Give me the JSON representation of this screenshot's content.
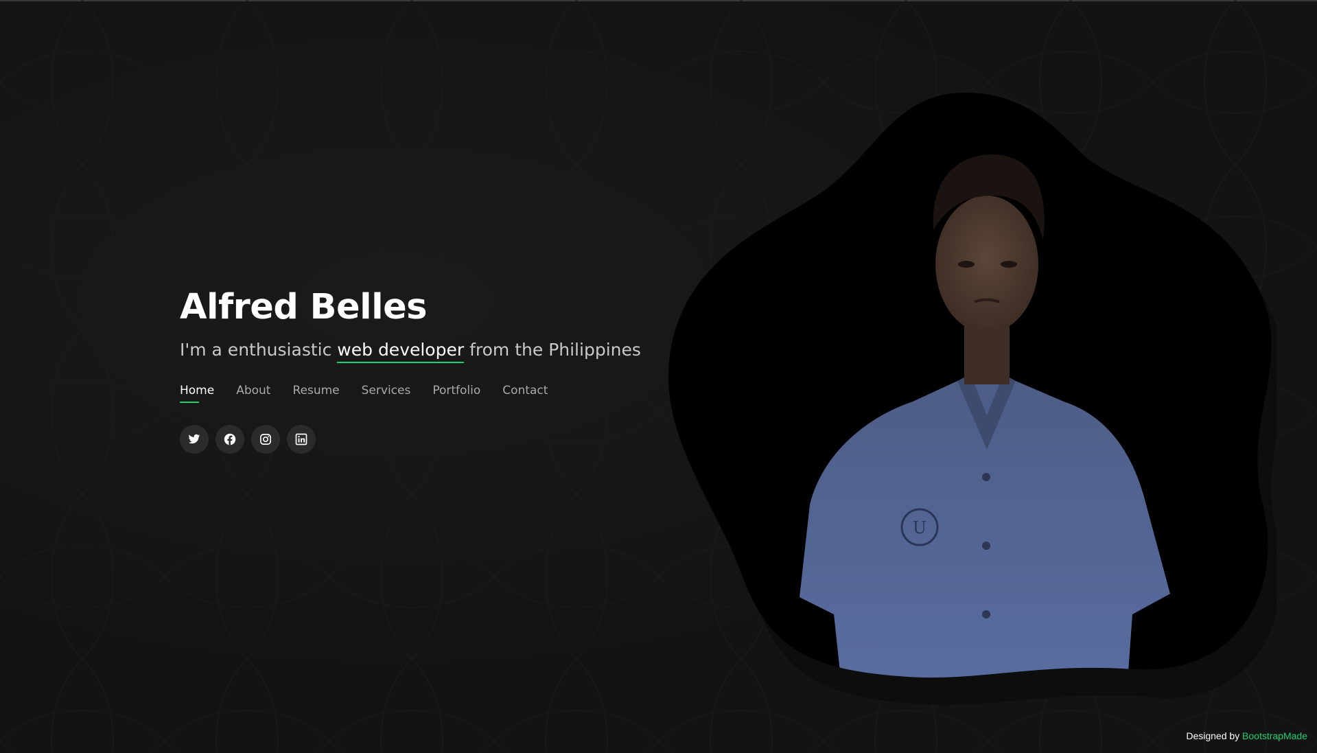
{
  "hero": {
    "name": "Alfred Belles",
    "tagline_prefix": "I'm a enthusiastic",
    "tagline_highlight": "web developer",
    "tagline_suffix": "from the Philippines"
  },
  "nav": {
    "items": [
      {
        "label": "Home",
        "active": true
      },
      {
        "label": "About"
      },
      {
        "label": "Resume"
      },
      {
        "label": "Services"
      },
      {
        "label": "Portfolio"
      },
      {
        "label": "Contact"
      }
    ]
  },
  "social": [
    {
      "icon": "twitter-icon"
    },
    {
      "icon": "facebook-icon"
    },
    {
      "icon": "instagram-icon"
    },
    {
      "icon": "linkedin-icon"
    }
  ],
  "footer": {
    "credit_prefix": "Designed by",
    "credit_link": "BootstrapMade"
  },
  "colors": {
    "accent": "#18d26e",
    "background": "#131313",
    "icon_button": "#2b2b2b"
  }
}
